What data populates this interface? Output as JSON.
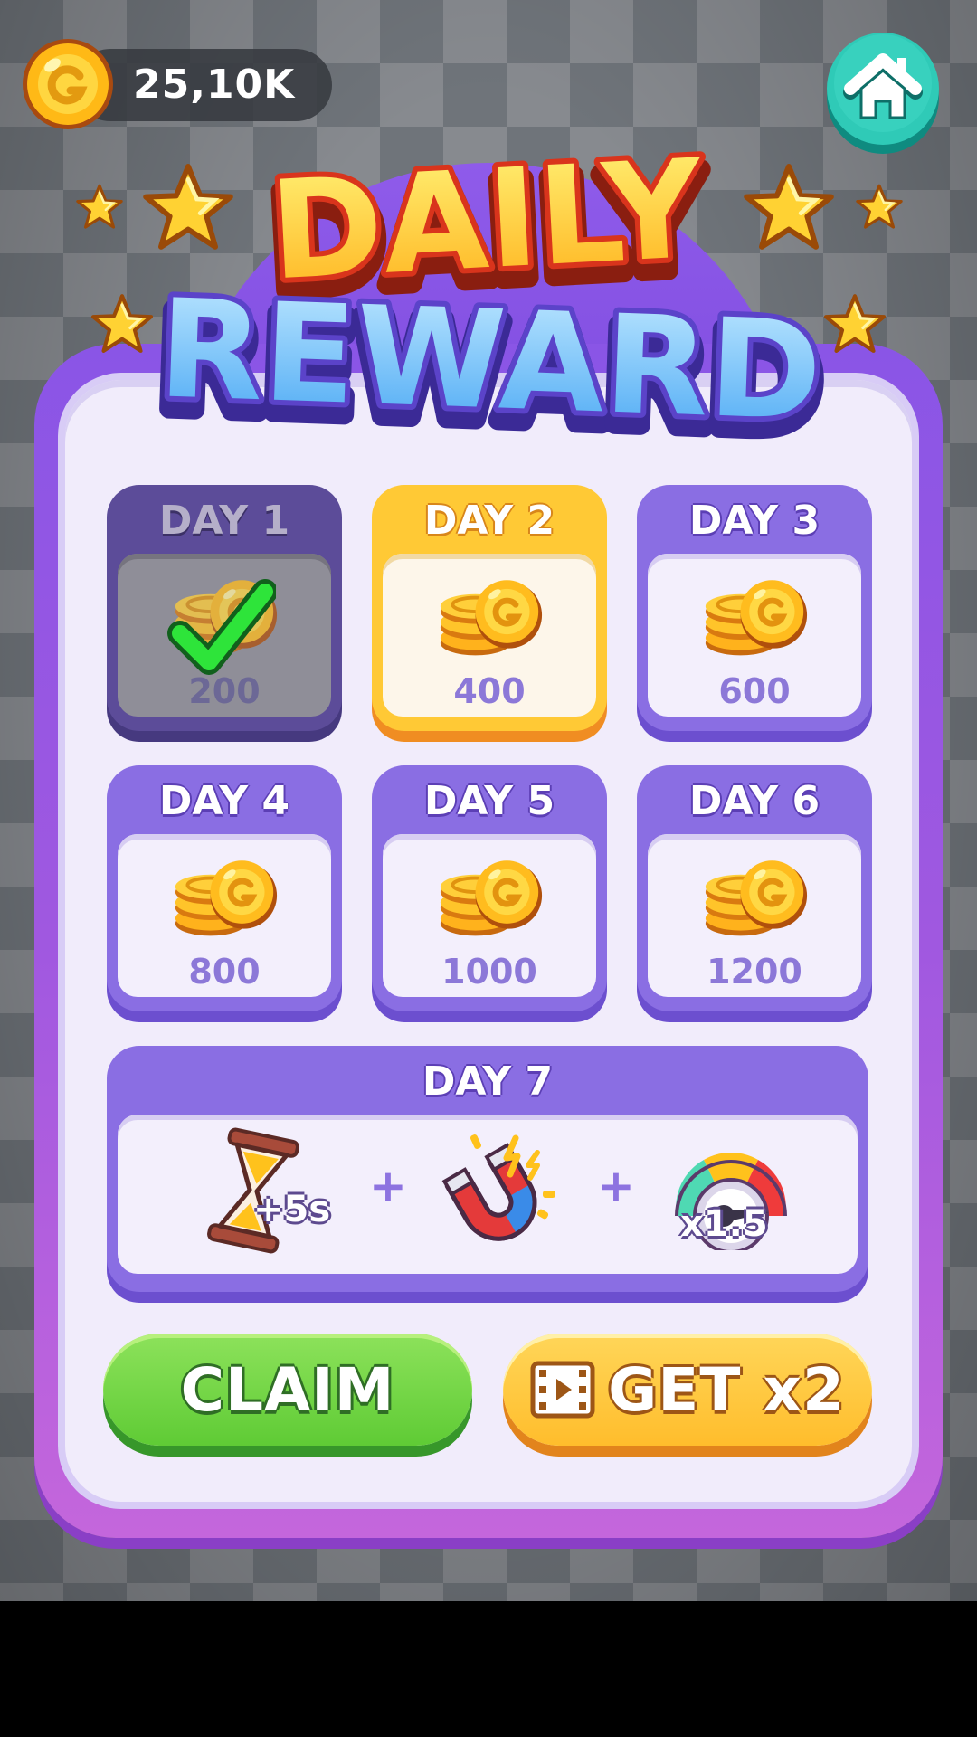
{
  "currency": {
    "amount": "25,10K",
    "icon": "gold-coin-icon"
  },
  "home_button": {
    "icon": "home-icon"
  },
  "title": {
    "line1": "DAILY",
    "line2": "REWARD"
  },
  "days": [
    {
      "label": "DAY 1",
      "amount": "200",
      "state": "claimed"
    },
    {
      "label": "DAY 2",
      "amount": "400",
      "state": "current"
    },
    {
      "label": "DAY 3",
      "amount": "600",
      "state": "locked"
    },
    {
      "label": "DAY 4",
      "amount": "800",
      "state": "locked"
    },
    {
      "label": "DAY 5",
      "amount": "1000",
      "state": "locked"
    },
    {
      "label": "DAY 6",
      "amount": "1200",
      "state": "locked"
    }
  ],
  "day7": {
    "label": "DAY 7",
    "rewards": [
      {
        "icon": "hourglass-icon",
        "text": "+5s"
      },
      {
        "icon": "magnet-icon",
        "text": ""
      },
      {
        "icon": "speedometer-icon",
        "text": "x1.5"
      }
    ],
    "separator": "+"
  },
  "buttons": {
    "claim": "CLAIM",
    "get_x2": "GET x2"
  },
  "colors": {
    "panel_purple": "#8a55e6",
    "card_purple": "#8a6ee3",
    "current_gold": "#ffc935",
    "claim_green": "#5fcb35",
    "check_green": "#22d63a"
  }
}
